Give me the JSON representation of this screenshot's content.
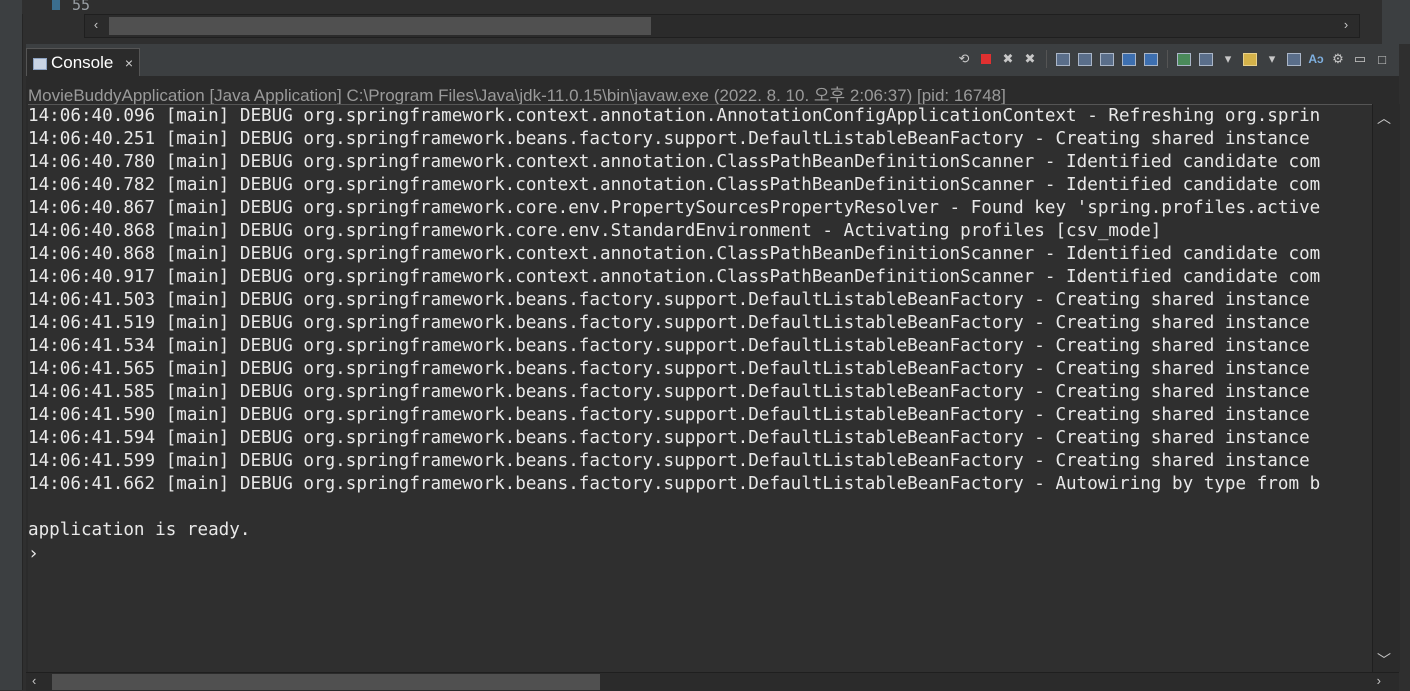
{
  "editor": {
    "line_number": "55"
  },
  "tab": {
    "label": "Console",
    "close_glyph": "×"
  },
  "toolbar_icons": [
    "terminate-relaunch-icon",
    "terminate-icon",
    "remove-launch-icon",
    "remove-all-icon",
    "clear-console-icon",
    "scroll-lock-icon",
    "word-wrap-icon",
    "show-on-stdout-icon",
    "show-on-stderr-icon",
    "pin-console-icon",
    "display-selected-console-icon",
    "new-console-icon",
    "copy-icon",
    "text-mode-icon",
    "settings-icon",
    "minimize-icon",
    "maximize-icon"
  ],
  "launch_info": "MovieBuddyApplication [Java Application] C:\\Program Files\\Java\\jdk-11.0.15\\bin\\javaw.exe  (2022. 8. 10. 오후 2:06:37) [pid: 16748]",
  "log_lines": [
    "14:06:40.096 [main] DEBUG org.springframework.context.annotation.AnnotationConfigApplicationContext - Refreshing org.sprin",
    "14:06:40.251 [main] DEBUG org.springframework.beans.factory.support.DefaultListableBeanFactory - Creating shared instance",
    "14:06:40.780 [main] DEBUG org.springframework.context.annotation.ClassPathBeanDefinitionScanner - Identified candidate com",
    "14:06:40.782 [main] DEBUG org.springframework.context.annotation.ClassPathBeanDefinitionScanner - Identified candidate com",
    "14:06:40.867 [main] DEBUG org.springframework.core.env.PropertySourcesPropertyResolver - Found key 'spring.profiles.active",
    "14:06:40.868 [main] DEBUG org.springframework.core.env.StandardEnvironment - Activating profiles [csv_mode]",
    "14:06:40.868 [main] DEBUG org.springframework.context.annotation.ClassPathBeanDefinitionScanner - Identified candidate com",
    "14:06:40.917 [main] DEBUG org.springframework.context.annotation.ClassPathBeanDefinitionScanner - Identified candidate com",
    "14:06:41.503 [main] DEBUG org.springframework.beans.factory.support.DefaultListableBeanFactory - Creating shared instance",
    "14:06:41.519 [main] DEBUG org.springframework.beans.factory.support.DefaultListableBeanFactory - Creating shared instance",
    "14:06:41.534 [main] DEBUG org.springframework.beans.factory.support.DefaultListableBeanFactory - Creating shared instance",
    "14:06:41.565 [main] DEBUG org.springframework.beans.factory.support.DefaultListableBeanFactory - Creating shared instance",
    "14:06:41.585 [main] DEBUG org.springframework.beans.factory.support.DefaultListableBeanFactory - Creating shared instance",
    "14:06:41.590 [main] DEBUG org.springframework.beans.factory.support.DefaultListableBeanFactory - Creating shared instance",
    "14:06:41.594 [main] DEBUG org.springframework.beans.factory.support.DefaultListableBeanFactory - Creating shared instance",
    "14:06:41.599 [main] DEBUG org.springframework.beans.factory.support.DefaultListableBeanFactory - Creating shared instance",
    "14:06:41.662 [main] DEBUG org.springframework.beans.factory.support.DefaultListableBeanFactory - Autowiring by type from b",
    "",
    "application is ready."
  ],
  "prompt": "›",
  "colors": {
    "background": "#2f2f2f",
    "text": "#e8e8e8",
    "launch_text": "#9a9a9a",
    "terminate_red": "#e03030"
  }
}
